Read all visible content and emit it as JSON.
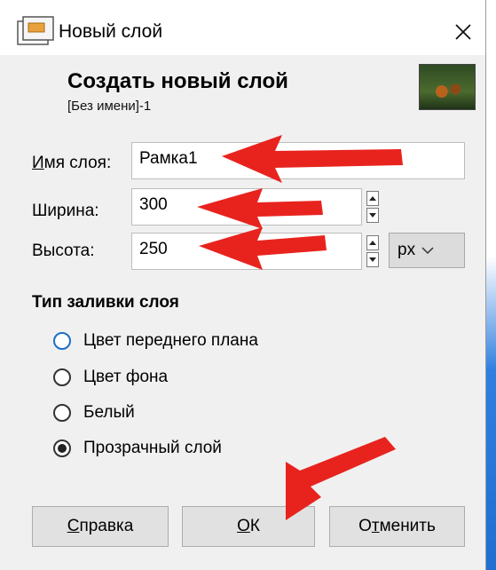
{
  "window": {
    "title": "Новый слой",
    "close_glyph": "✕"
  },
  "header": {
    "title": "Создать новый слой",
    "subtitle": "[Без имени]-1"
  },
  "form": {
    "layer_name": {
      "label_underlined": "И",
      "label_rest": "мя слоя:",
      "value": "Рамка1"
    },
    "width": {
      "label": "Ширина:",
      "value": "300"
    },
    "height": {
      "label": "Высота:",
      "value": "250"
    },
    "unit": {
      "value": "px",
      "chevron": "⌵"
    }
  },
  "fill": {
    "section_title": "Тип заливки слоя",
    "options": [
      {
        "label": "Цвет переднего плана",
        "checked": false
      },
      {
        "label": "Цвет фона",
        "checked": false
      },
      {
        "label": "Белый",
        "checked": false
      },
      {
        "label": "Прозрачный слой",
        "checked": true
      }
    ]
  },
  "buttons": {
    "help": {
      "u": "С",
      "rest": "правка"
    },
    "ok": {
      "u": "О",
      "rest": "К"
    },
    "cancel": {
      "pre": "О",
      "u": "т",
      "rest": "менить"
    }
  },
  "colors": {
    "annotation_arrow": "#e8231e",
    "dialog_bg": "#f0f0f0"
  }
}
